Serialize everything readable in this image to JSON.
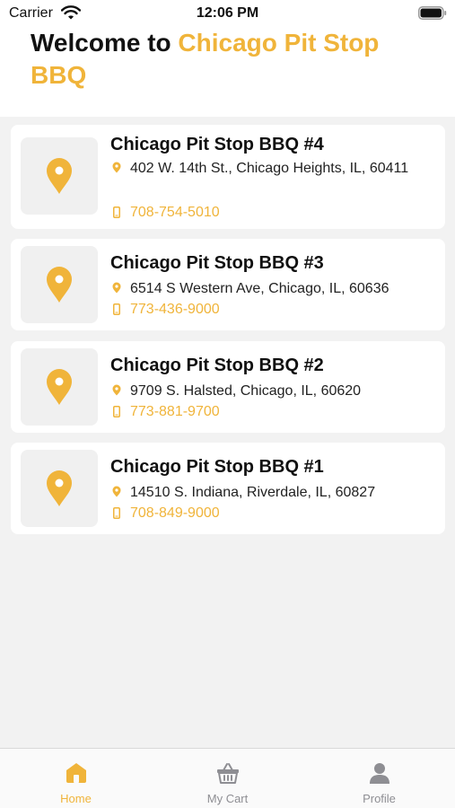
{
  "status_bar": {
    "carrier": "Carrier",
    "time": "12:06 PM"
  },
  "header": {
    "title_prefix": "Welcome to ",
    "title_brand": "Chicago Pit Stop BBQ"
  },
  "colors": {
    "accent": "#f0b43a",
    "background": "#f2f2f2"
  },
  "locations": [
    {
      "name": "Chicago Pit Stop BBQ #4",
      "address": "402 W. 14th St., Chicago Heights, IL, 60411",
      "phone": "708-754-5010"
    },
    {
      "name": "Chicago Pit Stop BBQ #3",
      "address": "6514 S Western Ave, Chicago, IL, 60636",
      "phone": "773-436-9000"
    },
    {
      "name": "Chicago Pit Stop BBQ #2",
      "address": "9709 S. Halsted, Chicago, IL, 60620",
      "phone": "773-881-9700"
    },
    {
      "name": "Chicago Pit Stop BBQ #1",
      "address": "14510 S. Indiana, Riverdale, IL, 60827",
      "phone": "708-849-9000"
    }
  ],
  "tabs": [
    {
      "label": "Home",
      "icon": "home-icon",
      "active": true
    },
    {
      "label": "My Cart",
      "icon": "basket-icon",
      "active": false
    },
    {
      "label": "Profile",
      "icon": "person-icon",
      "active": false
    }
  ]
}
